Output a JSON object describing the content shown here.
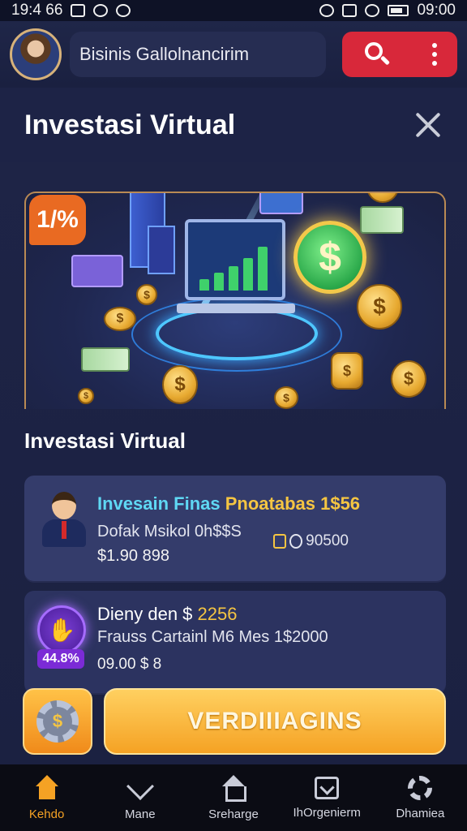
{
  "status_bar": {
    "time_left": "19:4 66",
    "time_right": "09:00"
  },
  "header": {
    "search_text": "Bisinis Gallolnancirim",
    "search_icon": "search-icon",
    "more_icon": "more-vertical-icon"
  },
  "panel": {
    "title": "Investasi Virtual",
    "close_icon": "close-icon"
  },
  "hero": {
    "badge": "1/%",
    "dollar_symbol": "$"
  },
  "section": {
    "title": "Investasi Virtual"
  },
  "cards": [
    {
      "title_part1": "Invesain Finas ",
      "title_part2": "Pnoatabas 1$56",
      "subtitle": "Dofak Msikol 0h$$S",
      "value": "$1.90 898",
      "side_value": "90500"
    },
    {
      "title_part1": "Dieny den $ ",
      "title_part2": "2256",
      "subtitle": "Frauss Cartainl M6 Mes 1$2000",
      "value": "09.00 $ 8",
      "badge_pct": "44.8%"
    }
  ],
  "actions": {
    "gear_icon": "gear-icon",
    "gear_symbol": "$",
    "primary_label": "VERDIIIAGINS"
  },
  "nav": [
    {
      "label": "Kehdo",
      "icon": "home-icon"
    },
    {
      "label": "Mane",
      "icon": "heart-icon"
    },
    {
      "label": "Sreharge",
      "icon": "home-outline-icon"
    },
    {
      "label": "IhOrgenierm",
      "icon": "inbox-icon"
    },
    {
      "label": "Dhamiea",
      "icon": "settings-icon"
    }
  ],
  "colors": {
    "accent": "#f5a224",
    "danger": "#d8283a",
    "background": "#1b2140",
    "card": "#343c6b"
  }
}
